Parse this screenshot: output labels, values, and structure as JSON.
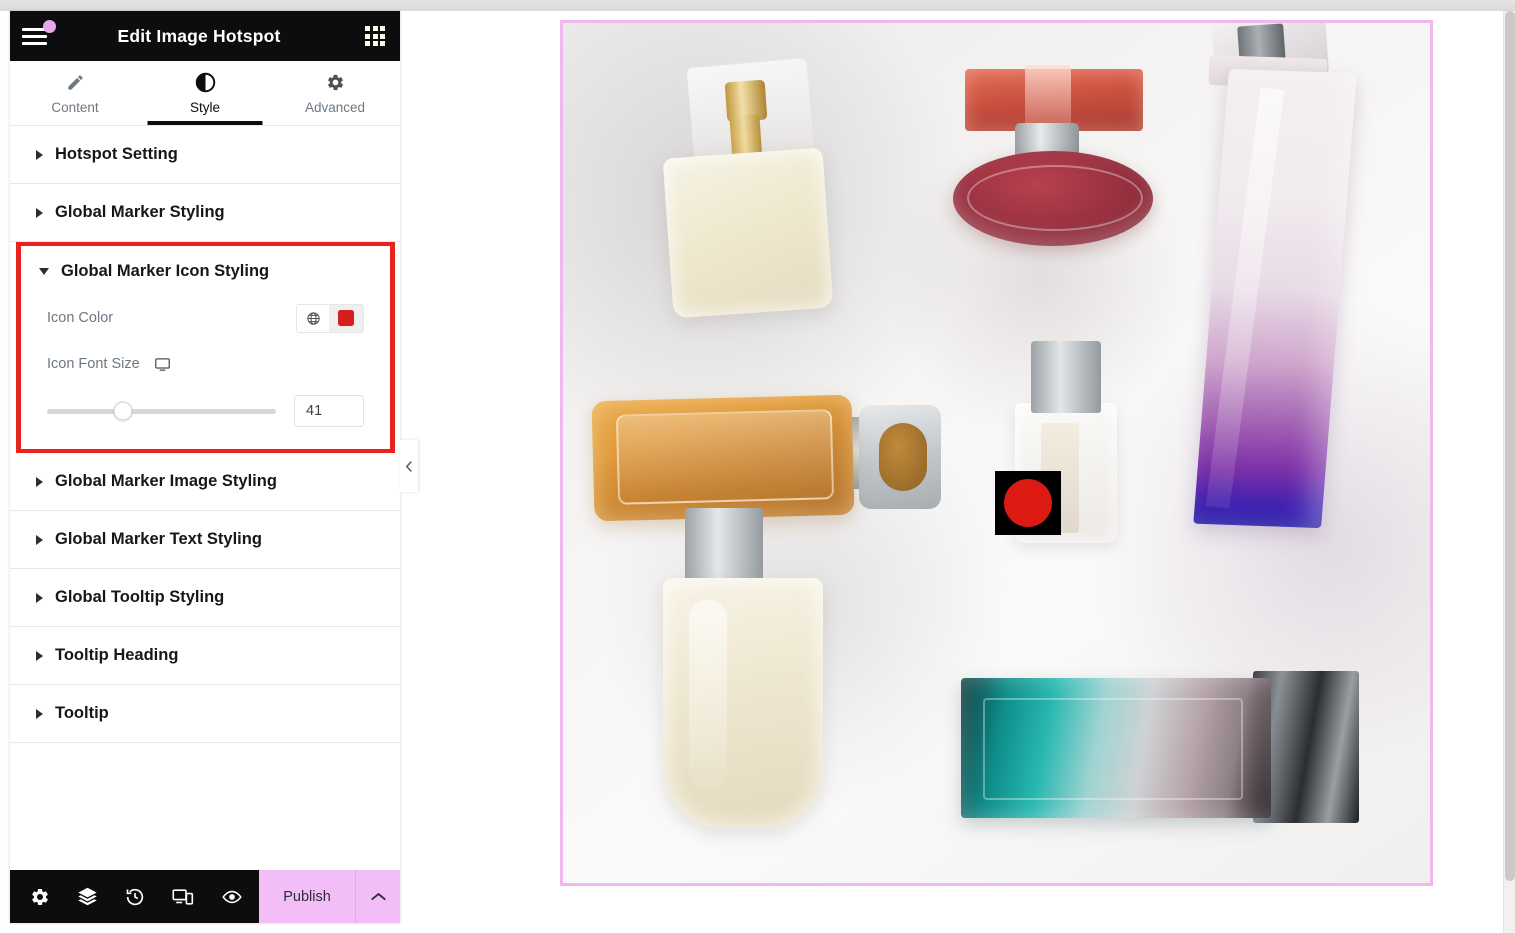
{
  "panel": {
    "title": "Edit Image Hotspot",
    "menu_icon": "hamburger-icon",
    "grid_icon": "apps-grid-icon",
    "tabs": [
      {
        "label": "Content",
        "icon": "pencil-icon",
        "active": false
      },
      {
        "label": "Style",
        "icon": "contrast-half-circle-icon",
        "active": true
      },
      {
        "label": "Advanced",
        "icon": "gear-icon",
        "active": false
      }
    ],
    "sections": [
      {
        "label": "Hotspot Setting",
        "open": false,
        "highlighted": false
      },
      {
        "label": "Global Marker Styling",
        "open": false,
        "highlighted": false
      },
      {
        "label": "Global Marker Icon Styling",
        "open": true,
        "highlighted": true
      },
      {
        "label": "Global Marker Image Styling",
        "open": false,
        "highlighted": false
      },
      {
        "label": "Global Marker Text Styling",
        "open": false,
        "highlighted": false
      },
      {
        "label": "Global Tooltip Styling",
        "open": false,
        "highlighted": false
      },
      {
        "label": "Tooltip Heading",
        "open": false,
        "highlighted": false
      },
      {
        "label": "Tooltip",
        "open": false,
        "highlighted": false
      }
    ],
    "icon_styling": {
      "icon_color_label": "Icon Color",
      "icon_color_globe_icon": "globe-icon",
      "icon_color_value": "#d41f1f",
      "icon_font_size_label": "Icon Font Size",
      "icon_font_size_device_icon": "desktop-monitor-icon",
      "icon_font_size_value": "41",
      "slider_percent": 33
    },
    "collapse_handle_icon": "chevron-left-icon",
    "footer": {
      "icons": [
        {
          "name": "gear-icon"
        },
        {
          "name": "layers-icon"
        },
        {
          "name": "history-revisions-icon"
        },
        {
          "name": "responsive-devices-icon"
        },
        {
          "name": "preview-eye-icon"
        }
      ],
      "publish_label": "Publish",
      "publish_caret_icon": "chevron-up-icon",
      "publish_color": "#f3bdf7"
    }
  },
  "canvas": {
    "image_border_color": "#f0b8ef",
    "hotspot_marker": {
      "name": "hotspot-marker",
      "background_color": "#000000",
      "dot_color": "#dd1a14"
    }
  }
}
